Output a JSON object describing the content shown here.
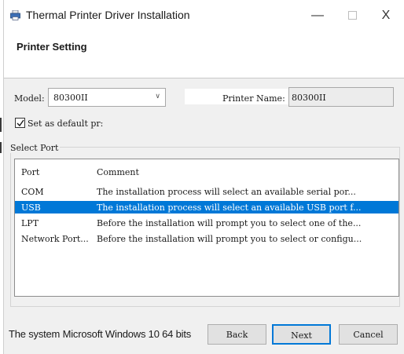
{
  "window": {
    "title": "Thermal Printer Driver Installation",
    "minimize_glyph": "—",
    "close_glyph": "X"
  },
  "header": {
    "title": "Printer Setting"
  },
  "model": {
    "label": "Model:",
    "value": "80300II"
  },
  "printer_name": {
    "label": "Printer Name:",
    "value": "80300II"
  },
  "default_checkbox": {
    "label": "Set as default pr:",
    "checked": true
  },
  "select_port": {
    "legend": "Select Port",
    "columns": [
      "Port",
      "Comment"
    ],
    "rows": [
      {
        "port": "COM",
        "comment": "The installation process will select an available serial por..."
      },
      {
        "port": "USB",
        "comment": "The installation process will select an available USB port f..."
      },
      {
        "port": "LPT",
        "comment": "Before the installation will prompt you to select one of the..."
      },
      {
        "port": "Network Port...",
        "comment": "Before the installation will prompt you to select or configu..."
      }
    ],
    "selected_port": "USB"
  },
  "footer": {
    "os_text": "The system Microsoft Windows 10 64 bits",
    "back_label": "Back",
    "next_label": "Next",
    "cancel_label": "Cancel"
  },
  "colors": {
    "selection": "#0078d7",
    "window_bg": "#f0f0f0",
    "focus_border": "#0078d7"
  }
}
